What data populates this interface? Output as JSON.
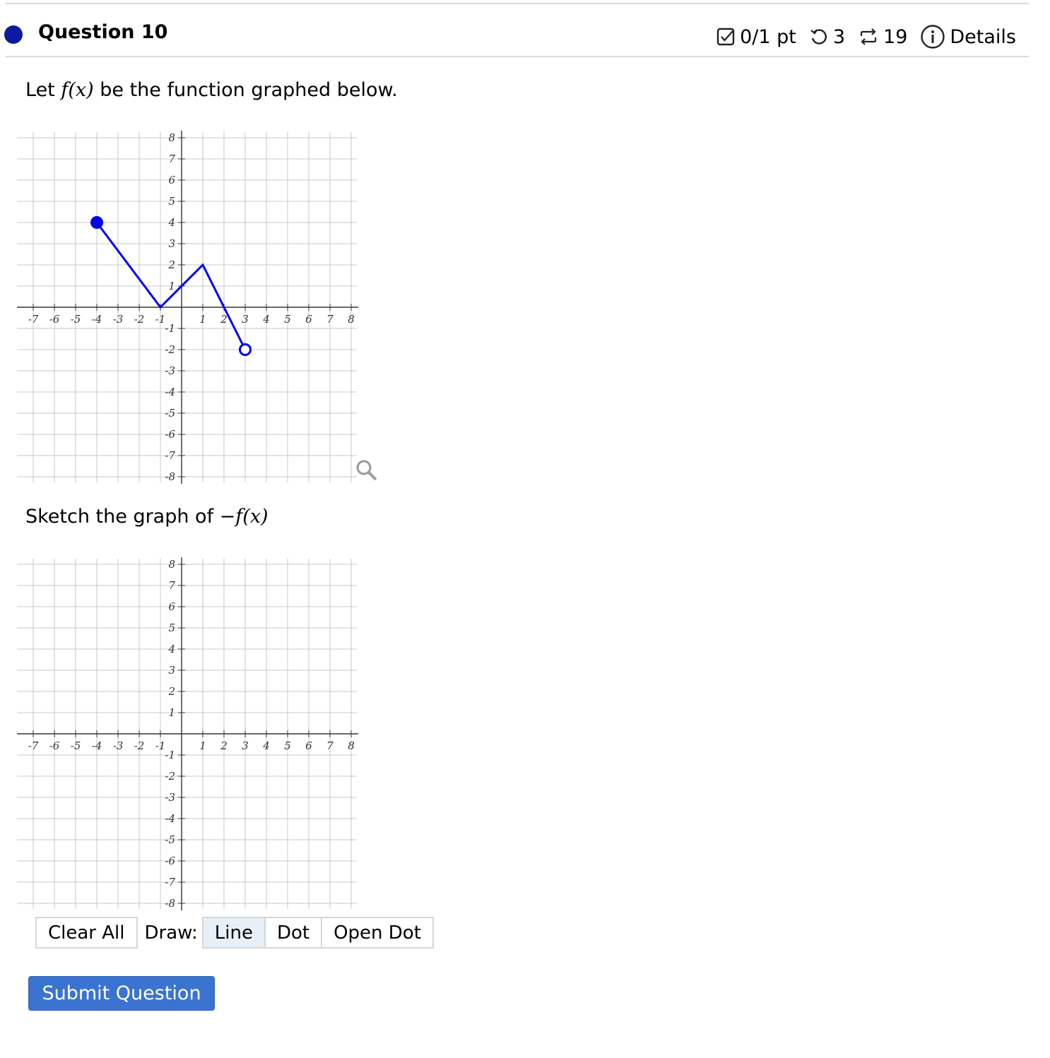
{
  "header": {
    "question_title": "Question 10",
    "score": "0/1 pt",
    "retries": "3",
    "submissions": "19",
    "details_label": "Details"
  },
  "prompt1": {
    "before": "Let ",
    "math": "f(x)",
    "after": " be the function graphed below."
  },
  "prompt2": {
    "before": "Sketch the graph of ",
    "math": "−f(x)"
  },
  "graph_axis": {
    "x_ticks": [
      -8,
      -7,
      -6,
      -5,
      -4,
      -3,
      -2,
      -1,
      1,
      2,
      3,
      4,
      5,
      6,
      7,
      8
    ],
    "y_ticks": [
      8,
      7,
      6,
      5,
      4,
      3,
      2,
      1,
      -1,
      -2,
      -3,
      -4,
      -5,
      -6,
      -7,
      -8
    ],
    "range": [
      -8,
      8
    ]
  },
  "function_graph": {
    "vertices": [
      [
        -4,
        4
      ],
      [
        -1,
        0
      ],
      [
        1,
        2
      ],
      [
        3,
        -2
      ]
    ],
    "closed_endpoint": [
      -4,
      4
    ],
    "open_endpoint": [
      3,
      -2
    ],
    "color": "#0000ee"
  },
  "toolbar": {
    "clear_label": "Clear All",
    "draw_label": "Draw:",
    "line_label": "Line",
    "dot_label": "Dot",
    "open_dot_label": "Open Dot"
  },
  "submit_label": "Submit Question",
  "colors": {
    "question_dot": "#0d1a9e",
    "submit_bg": "#3b73d1"
  }
}
